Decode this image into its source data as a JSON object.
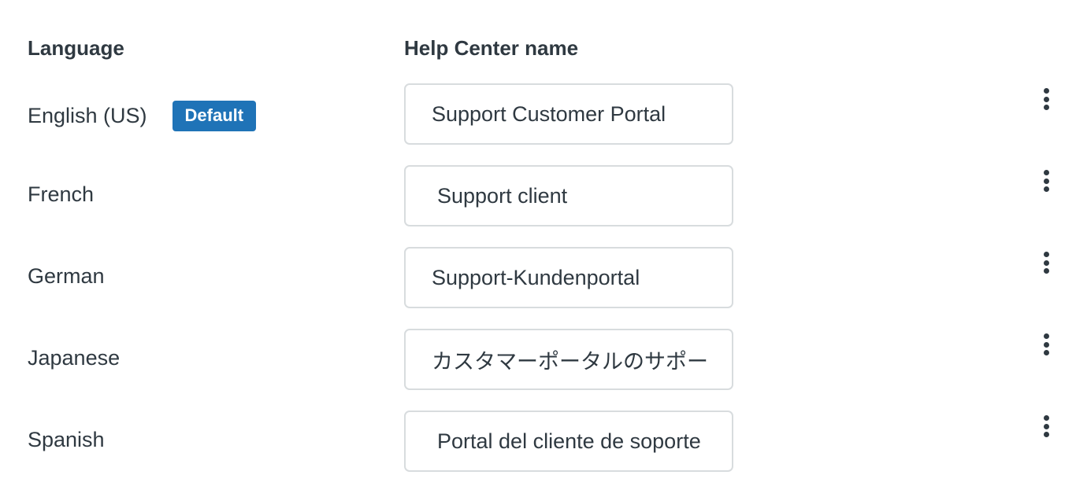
{
  "headers": {
    "language": "Language",
    "help_center_name": "Help Center name"
  },
  "rows": [
    {
      "language": "English (US)",
      "badge": "Default",
      "name": "Support Customer Portal",
      "menu_icon": "kebab-menu-icon"
    },
    {
      "language": "French",
      "name": "Support client",
      "menu_icon": "kebab-menu-icon"
    },
    {
      "language": "German",
      "name": "Support-Kundenportal",
      "menu_icon": "kebab-menu-icon"
    },
    {
      "language": "Japanese",
      "name": "カスタマーポータルのサポート",
      "menu_icon": "kebab-menu-icon"
    },
    {
      "language": "Spanish",
      "name": "Portal del cliente de soporte",
      "menu_icon": "kebab-menu-icon"
    }
  ],
  "colors": {
    "badge": "#1f73b7",
    "text": "#2f3941",
    "border": "#d8dcde"
  }
}
